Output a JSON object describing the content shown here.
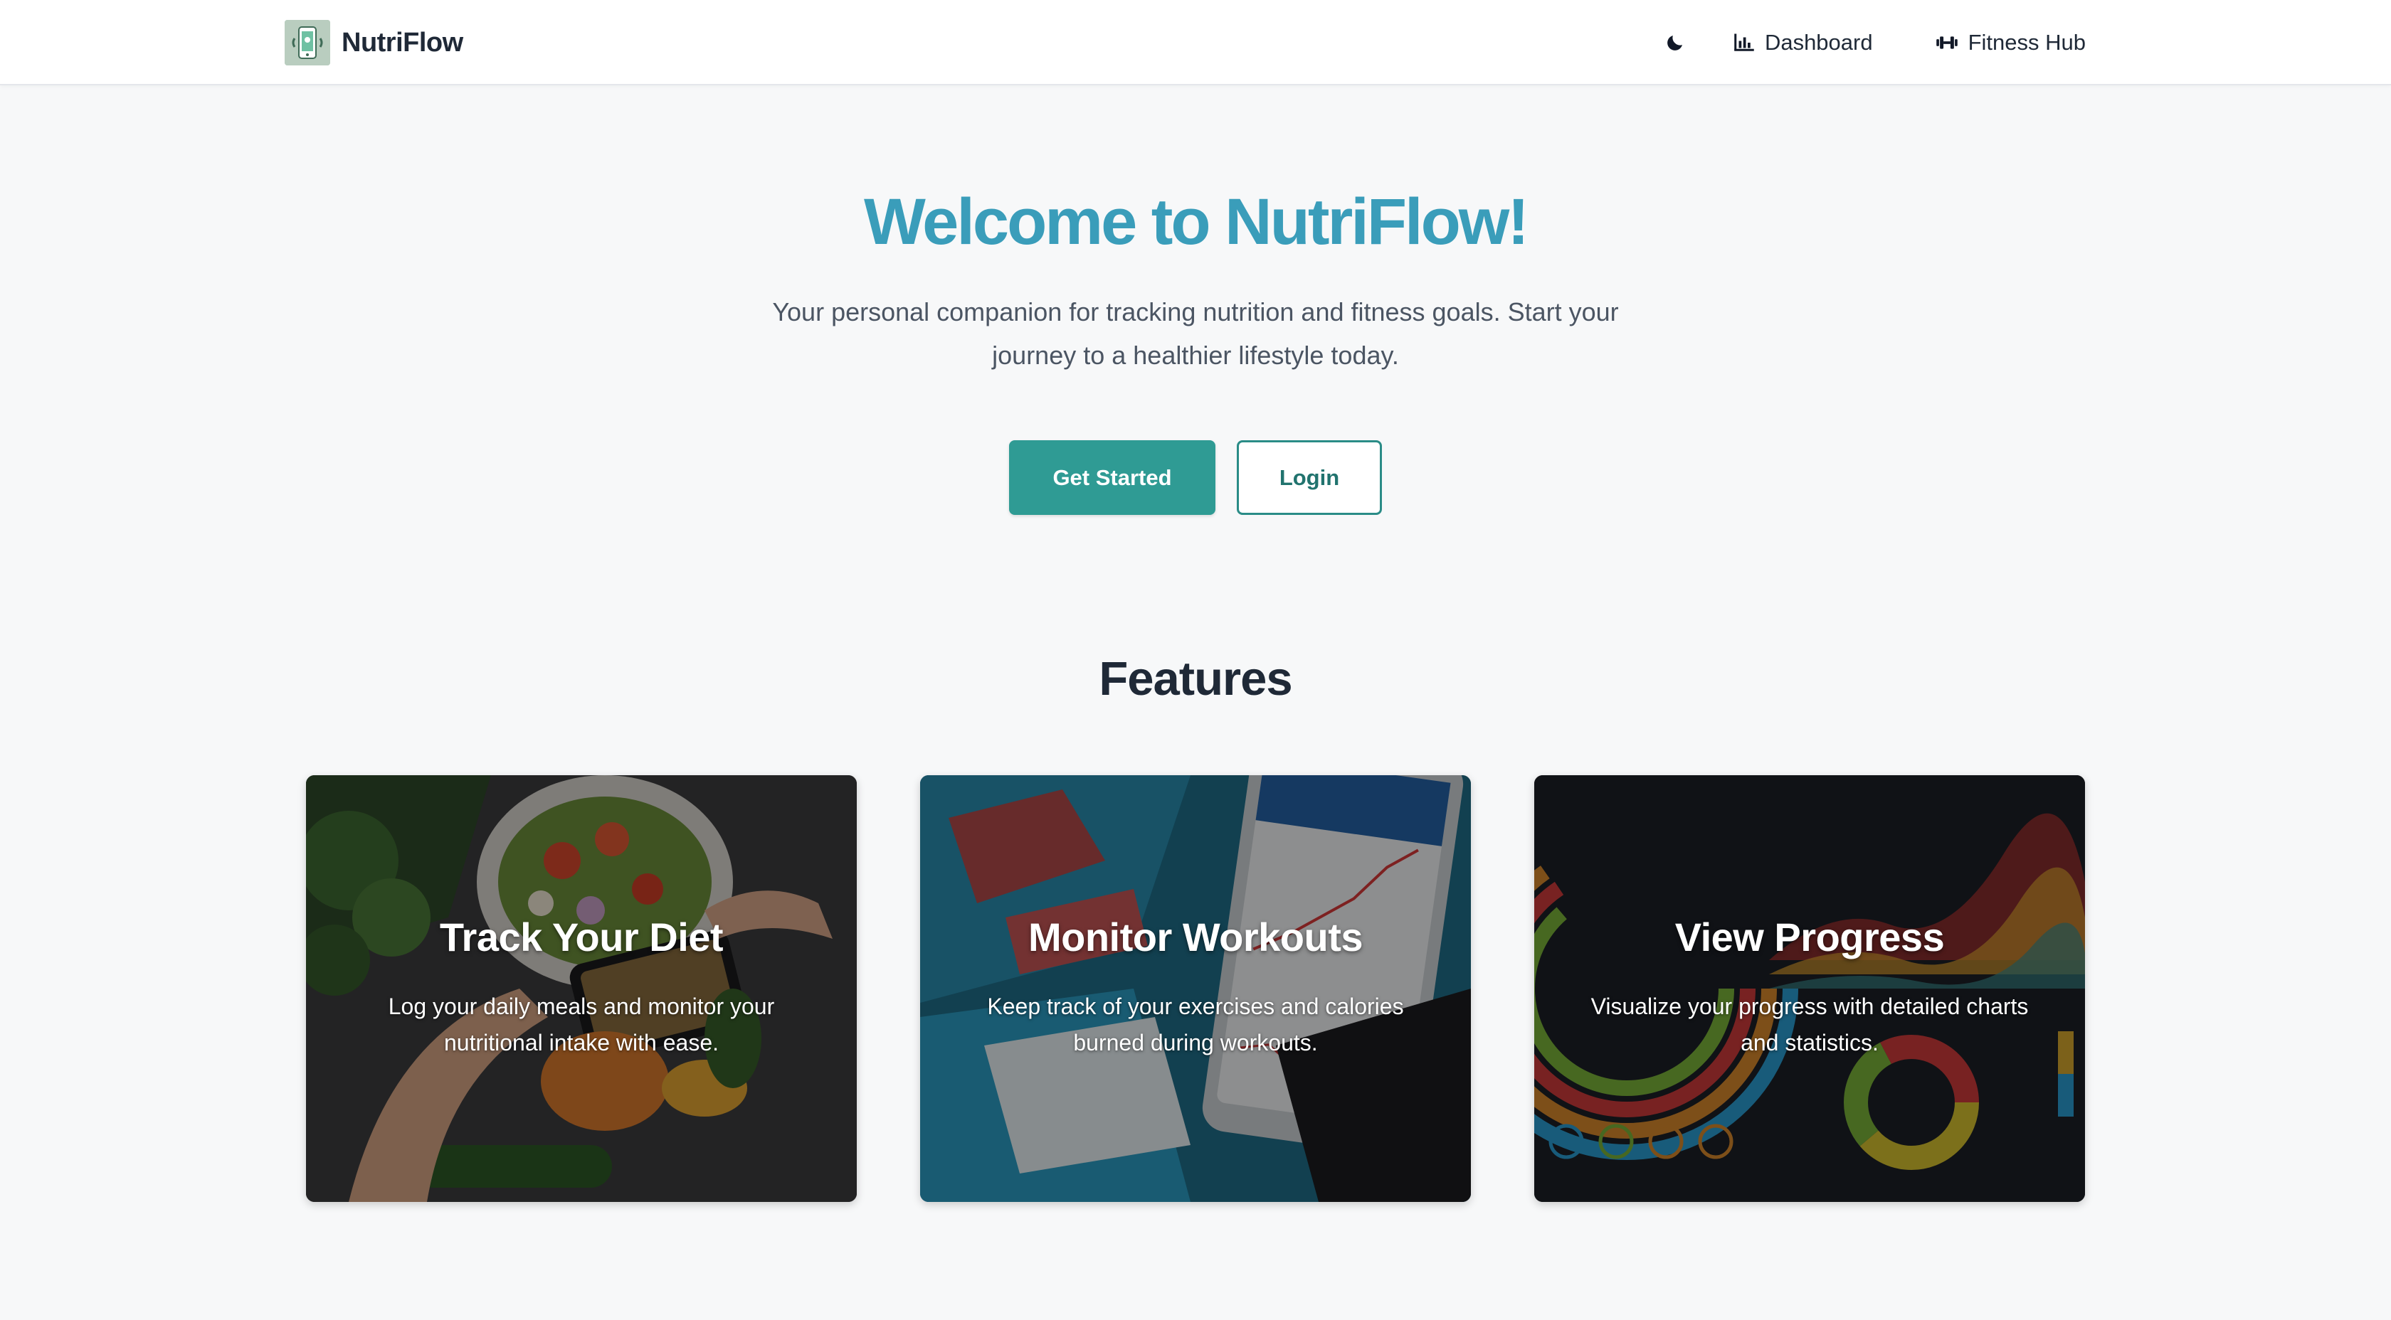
{
  "navbar": {
    "brand_name": "NutriFlow",
    "logo_icon": "phone-scale-icon",
    "theme_toggle_icon": "moon-icon",
    "links": [
      {
        "label": "Dashboard",
        "icon": "bar-chart-icon"
      },
      {
        "label": "Fitness Hub",
        "icon": "dumbbell-icon"
      }
    ]
  },
  "hero": {
    "title": "Welcome to NutriFlow!",
    "subtitle": "Your personal companion for tracking nutrition and fitness goals. Start your journey to a healthier lifestyle today.",
    "primary_button": "Get Started",
    "secondary_button": "Login"
  },
  "features": {
    "heading": "Features",
    "cards": [
      {
        "title": "Track Your Diet",
        "description": "Log your daily meals and monitor your nutritional intake with ease.",
        "image": "salad-bowl-photo"
      },
      {
        "title": "Monitor Workouts",
        "description": "Keep track of your exercises and calories burned during workouts.",
        "image": "phone-workout-app-photo"
      },
      {
        "title": "View Progress",
        "description": "Visualize your progress with detailed charts and statistics.",
        "image": "dashboard-charts-photo"
      }
    ]
  },
  "colors": {
    "accent": "#3a9dba",
    "primary_button": "#2f9b94",
    "outline_button": "#2a8c87",
    "page_background": "#f7f8f9"
  }
}
